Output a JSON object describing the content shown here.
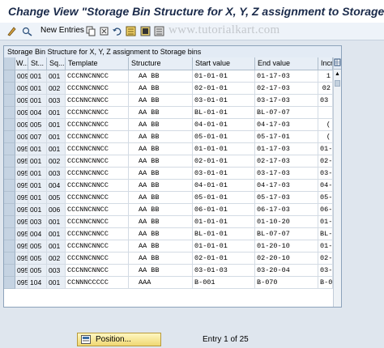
{
  "window": {
    "title": "Change View \"Storage Bin Structure for X, Y, Z assignment to Storage b"
  },
  "toolbar": {
    "new_entries_label": "New Entries",
    "icons": [
      "pencil-glasses-icon",
      "display-change-icon",
      "copy-icon",
      "delete-icon",
      "undo-icon",
      "select-all-icon",
      "select-block-icon",
      "deselect-icon"
    ]
  },
  "watermark": "www.tutorialkart.com",
  "table": {
    "caption": "Storage Bin Structure for X, Y, Z assignment to Storage bins",
    "columns": [
      "W...",
      "St...",
      "Sq...",
      "Template",
      "Structure",
      "Start value",
      "End value",
      "Incr"
    ],
    "rows": [
      {
        "wh": "009",
        "st": "001",
        "sq": "001",
        "template": "CCCNNCNNCC",
        "structure": "AA BB",
        "start": "01-01-01",
        "end": "01-17-03",
        "incr": "1"
      },
      {
        "wh": "009",
        "st": "001",
        "sq": "002",
        "template": "CCCNNCNNCC",
        "structure": "AA BB",
        "start": "02-01-01",
        "end": "02-17-03",
        "incr": "02"
      },
      {
        "wh": "009",
        "st": "001",
        "sq": "003",
        "template": "CCCNNCNNCC",
        "structure": "AA BB",
        "start": "03-01-01",
        "end": "03-17-03",
        "incr": "03 0"
      },
      {
        "wh": "009",
        "st": "004",
        "sq": "001",
        "template": "CCCNNCNNCC",
        "structure": "AA BB",
        "start": "BL-01-01",
        "end": "BL-07-07",
        "incr": ""
      },
      {
        "wh": "009",
        "st": "005",
        "sq": "001",
        "template": "CCCNNCNNCC",
        "structure": "AA BB",
        "start": "04-01-01",
        "end": "04-17-03",
        "incr": "("
      },
      {
        "wh": "009",
        "st": "007",
        "sq": "001",
        "template": "CCCNNCNNCC",
        "structure": "AA BB",
        "start": "05-01-01",
        "end": "05-17-01",
        "incr": "("
      },
      {
        "wh": "095",
        "st": "001",
        "sq": "001",
        "template": "CCCNNCNNCC",
        "structure": "AA BB",
        "start": "01-01-01",
        "end": "01-17-03",
        "incr": "01-0"
      },
      {
        "wh": "095",
        "st": "001",
        "sq": "002",
        "template": "CCCNNCNNCC",
        "structure": "AA BB",
        "start": "02-01-01",
        "end": "02-17-03",
        "incr": "02-0"
      },
      {
        "wh": "095",
        "st": "001",
        "sq": "003",
        "template": "CCCNNCNNCC",
        "structure": "AA BB",
        "start": "03-01-01",
        "end": "03-17-03",
        "incr": "03-0"
      },
      {
        "wh": "095",
        "st": "001",
        "sq": "004",
        "template": "CCCNNCNNCC",
        "structure": "AA BB",
        "start": "04-01-01",
        "end": "04-17-03",
        "incr": "04-0"
      },
      {
        "wh": "095",
        "st": "001",
        "sq": "005",
        "template": "CCCNNCNNCC",
        "structure": "AA BB",
        "start": "05-01-01",
        "end": "05-17-03",
        "incr": "05-0"
      },
      {
        "wh": "095",
        "st": "001",
        "sq": "006",
        "template": "CCCNNCNNCC",
        "structure": "AA BB",
        "start": "06-01-01",
        "end": "06-17-03",
        "incr": "06-0"
      },
      {
        "wh": "095",
        "st": "003",
        "sq": "001",
        "template": "CCCNNCNNCC",
        "structure": "AA BB",
        "start": "01-01-01",
        "end": "01-10-20",
        "incr": "01-0"
      },
      {
        "wh": "095",
        "st": "004",
        "sq": "001",
        "template": "CCCNNCNNCC",
        "structure": "AA BB",
        "start": "BL-01-01",
        "end": "BL-07-07",
        "incr": "BL-0"
      },
      {
        "wh": "095",
        "st": "005",
        "sq": "001",
        "template": "CCCNNCNNCC",
        "structure": "AA BB",
        "start": "01-01-01",
        "end": "01-20-10",
        "incr": "01-0"
      },
      {
        "wh": "095",
        "st": "005",
        "sq": "002",
        "template": "CCCNNCNNCC",
        "structure": "AA BB",
        "start": "02-01-01",
        "end": "02-20-10",
        "incr": "02-0"
      },
      {
        "wh": "095",
        "st": "005",
        "sq": "003",
        "template": "CCCNNCNNCC",
        "structure": "AA BB",
        "start": "03-01-03",
        "end": "03-20-04",
        "incr": "03-0"
      },
      {
        "wh": "095",
        "st": "104",
        "sq": "001",
        "template": "CCNNNCCCCC",
        "structure": "AAA",
        "start": "B-001",
        "end": "B-070",
        "incr": "B-0"
      }
    ]
  },
  "footer": {
    "position_button_label": "Position...",
    "entry_text": "Entry 1 of 25"
  },
  "colors": {
    "header_bg": "#e7eef6",
    "key_cell_bg": "#e8eef5",
    "button_accent": "#f0d873"
  }
}
